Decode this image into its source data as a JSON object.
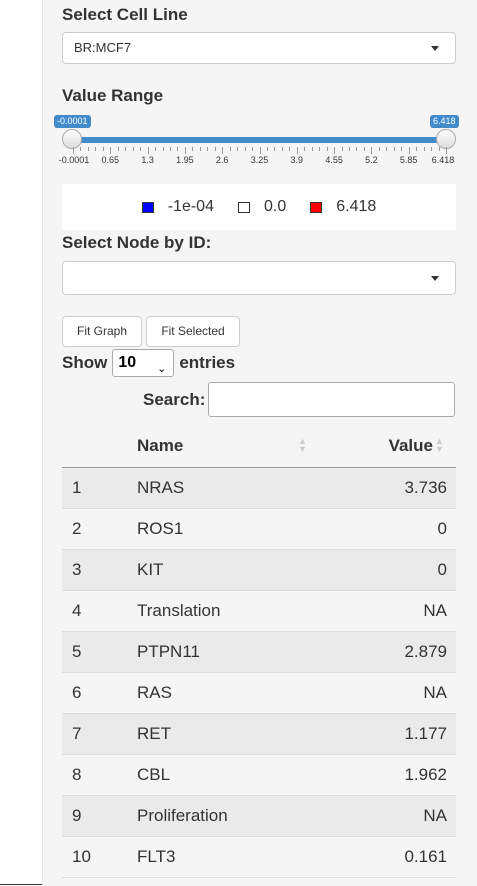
{
  "cell_line": {
    "label": "Select Cell Line",
    "selected": "BR:MCF7"
  },
  "value_range": {
    "label": "Value Range",
    "min_badge": "-0.0001",
    "max_badge": "6.418",
    "ticks": [
      "-0.0001",
      "0.65",
      "1.3",
      "1.95",
      "2.6",
      "3.25",
      "3.9",
      "4.55",
      "5.2",
      "5.85",
      "6.418"
    ],
    "accent": "#428bca"
  },
  "legend": [
    {
      "text": "-1e-04",
      "color": "#0000ff"
    },
    {
      "text": "0.0",
      "color": "#ffffff"
    },
    {
      "text": "6.418",
      "color": "#ff0000"
    }
  ],
  "node_select": {
    "label": "Select Node by ID:",
    "selected": ""
  },
  "buttons": {
    "fit_graph": "Fit Graph",
    "fit_selected": "Fit Selected"
  },
  "entries": {
    "show": "Show",
    "value": "10",
    "suffix": "entries"
  },
  "search": {
    "label": "Search:",
    "value": ""
  },
  "table": {
    "headers": {
      "index": "",
      "name": "Name",
      "value": "Value"
    },
    "rows": [
      {
        "idx": "1",
        "name": "NRAS",
        "value": "3.736"
      },
      {
        "idx": "2",
        "name": "ROS1",
        "value": "0"
      },
      {
        "idx": "3",
        "name": "KIT",
        "value": "0"
      },
      {
        "idx": "4",
        "name": "Translation",
        "value": "NA"
      },
      {
        "idx": "5",
        "name": "PTPN11",
        "value": "2.879"
      },
      {
        "idx": "6",
        "name": "RAS",
        "value": "NA"
      },
      {
        "idx": "7",
        "name": "RET",
        "value": "1.177"
      },
      {
        "idx": "8",
        "name": "CBL",
        "value": "1.962"
      },
      {
        "idx": "9",
        "name": "Proliferation",
        "value": "NA"
      },
      {
        "idx": "10",
        "name": "FLT3",
        "value": "0.161"
      }
    ]
  }
}
